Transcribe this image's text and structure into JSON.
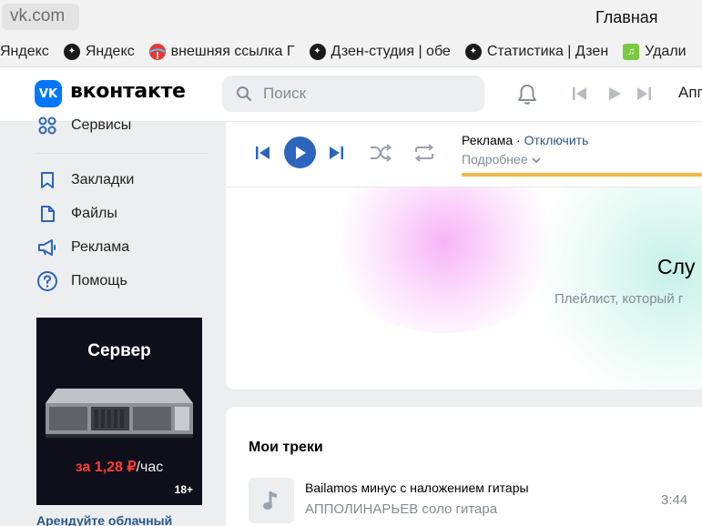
{
  "browser": {
    "url": "vk.com",
    "tab_title": "Главная"
  },
  "bookmarks": [
    {
      "label": "Яндекс",
      "icon": "dark-circle-icon"
    },
    {
      "label": "Яндекс",
      "icon": "yandex-star-icon"
    },
    {
      "label": "внешняя ссылка Г",
      "icon": "globe-icon"
    },
    {
      "label": "Дзен-студия | обе",
      "icon": "zen-icon"
    },
    {
      "label": "Статистика | Дзен",
      "icon": "zen-icon"
    },
    {
      "label": "Удали",
      "icon": "music-icon"
    }
  ],
  "header": {
    "logo_text": "вконтакте",
    "logo_mark": "VK",
    "search_placeholder": "Поиск",
    "app_label": "Апп"
  },
  "sidebar": {
    "items": [
      {
        "label": "Сервисы",
        "icon": "services-icon"
      },
      {
        "label": "Закладки",
        "icon": "bookmark-icon"
      },
      {
        "label": "Файлы",
        "icon": "file-icon"
      },
      {
        "label": "Реклама",
        "icon": "megaphone-icon"
      },
      {
        "label": "Помощь",
        "icon": "help-icon"
      }
    ],
    "ad": {
      "title": "Сервер",
      "price_accent": "за 1,28 ₽",
      "price_rest": "/час",
      "age": "18+",
      "caption": "Арендуйте облачный"
    }
  },
  "player": {
    "ad_label": "Реклама ·",
    "disable_label": "Отключить",
    "more_label": "Подробнее",
    "progress_fraction": 1.0,
    "accent_color": "#2d64bc",
    "progress_color": "#f0b849"
  },
  "hero": {
    "title": "Слу",
    "subtitle": "Плейлист, который г"
  },
  "tracks": {
    "title": "Мои треки",
    "items": [
      {
        "name": "Bailamos минус с наложением гитары",
        "artist": "АППОЛИНАРЬЕВ соло гитара",
        "duration": "3:44"
      }
    ]
  }
}
